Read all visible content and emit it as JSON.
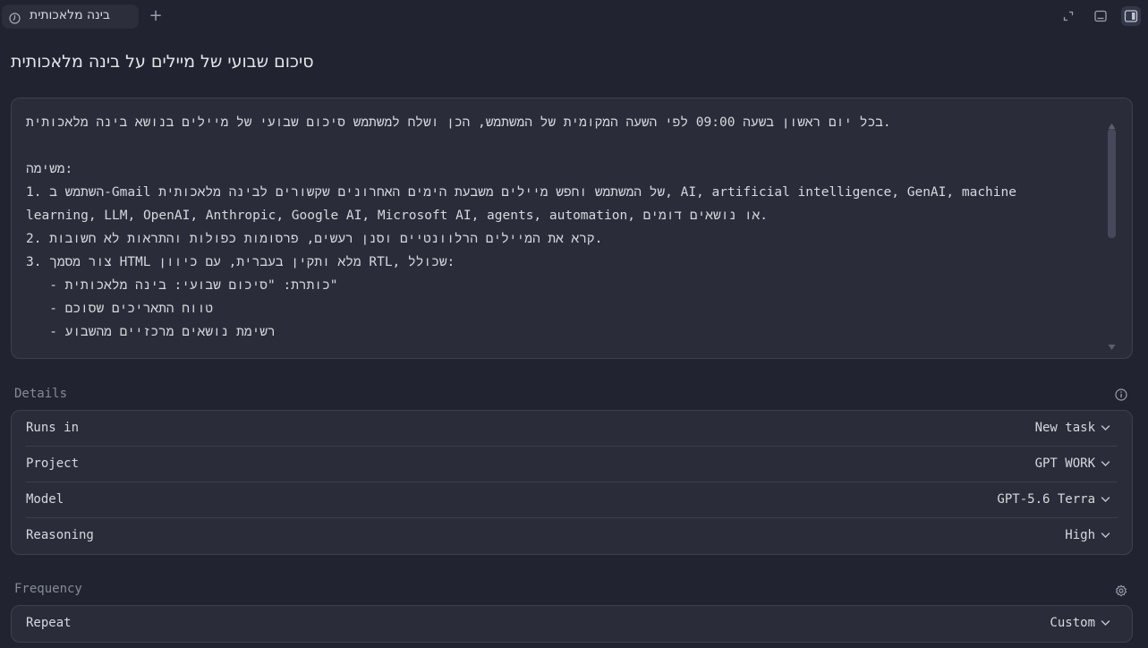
{
  "tab": {
    "title": "בינה מלאכותית",
    "icon": "clock-icon"
  },
  "top_bar": {
    "new_tab_label": "+",
    "icons": [
      "expand-icon",
      "panel-bottom-icon",
      "panel-right-icon"
    ]
  },
  "page_title": "סיכום שבועי של מיילים על בינה מלאכותית",
  "prompt": {
    "lines": [
      "בכל יום ראשון בשעה 09:00 לפי השעה המקומית של המשתמש, הכן ושלח למשתמש סיכום שבועי של מיילים בנושא בינה מלאכותית.",
      "",
      "משימה:",
      "1. השתמש ב-Gmail של המשתמש וחפש מיילים משבעת הימים האחרונים שקשורים לבינה מלאכותית, AI, artificial intelligence, GenAI, machine",
      "learning, LLM, OpenAI, Anthropic, Google AI, Microsoft AI, agents, automation, או נושאים דומים.",
      "2. קרא את המיילים הרלוונטיים וסנן רעשים, פרסומות כפולות והתראות לא חשובות.",
      "3. צור מסמך HTML מלא ותקין בעברית, עם כיוון RTL, שכולל:",
      "   - כותרת: \"סיכום שבועי: בינה מלאכותית\"",
      "   - טווח התאריכים שסוכם",
      "   - רשימת נושאים מרכזיים מהשבוע"
    ]
  },
  "details": {
    "label": "Details",
    "info_icon": "info-icon",
    "rows": [
      {
        "label": "Runs in",
        "value": "New task"
      },
      {
        "label": "Project",
        "value": "GPT WORK"
      },
      {
        "label": "Model",
        "value": "GPT-5.6 Terra"
      },
      {
        "label": "Reasoning",
        "value": "High"
      }
    ]
  },
  "frequency": {
    "label": "Frequency",
    "settings_icon": "gear-icon",
    "rows": [
      {
        "label": "Repeat",
        "value": "Custom"
      }
    ]
  }
}
